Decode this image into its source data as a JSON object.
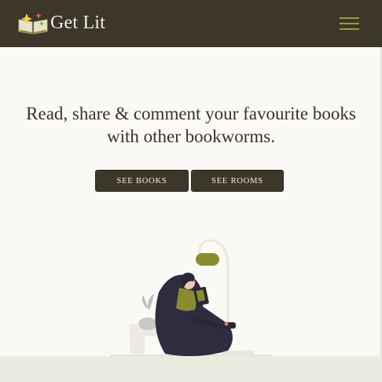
{
  "navbar": {
    "brand_name": "Get Lit",
    "brand_logo_icon": "open-book-sparkle-icon",
    "menu_icon": "hamburger-menu-icon"
  },
  "hero": {
    "headline": "Read, share & comment your favourite books with other bookworms.",
    "buttons": {
      "books_label": "SEE BOOKS",
      "rooms_label": "SEE ROOMS"
    }
  },
  "illustration": {
    "icon": "person-reading-beanbag-icon"
  },
  "colors": {
    "navbar_bg": "#3d362b",
    "accent_olive": "#9a9b3d",
    "page_bg": "#faf9f5",
    "footer_bg": "#ecebe0"
  }
}
